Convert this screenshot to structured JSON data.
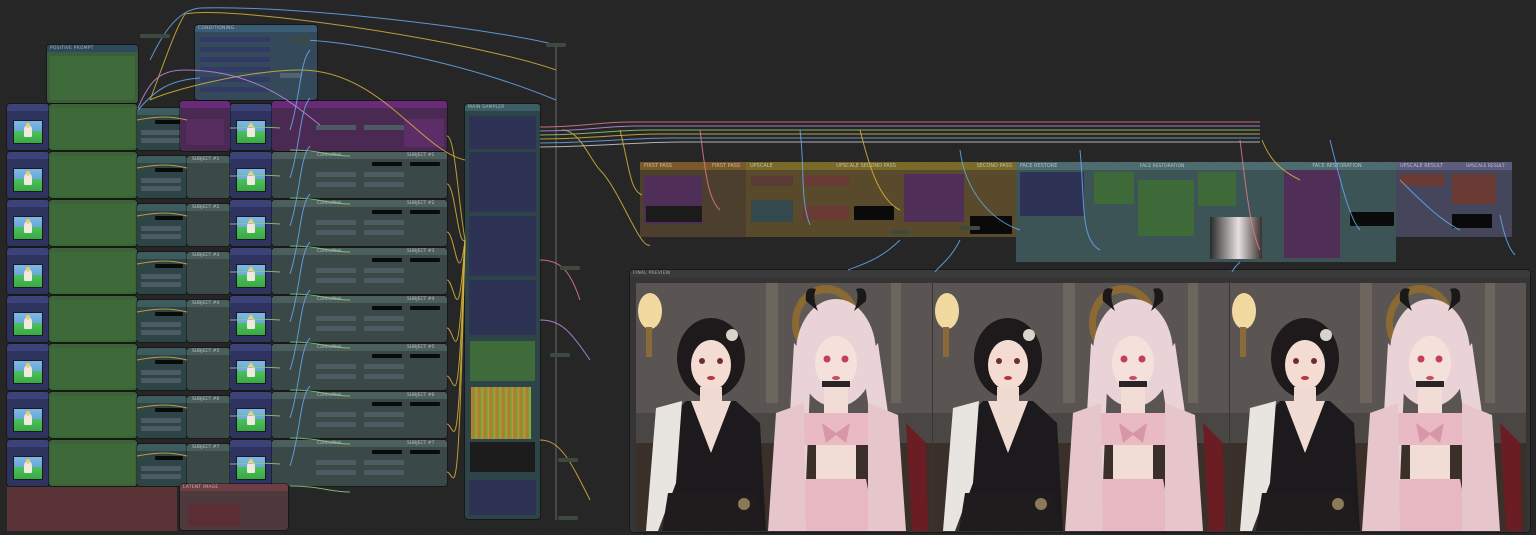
{
  "app": "ComfyUI",
  "node_titles": {
    "prompt_top": "POSITIVE PROMPT",
    "condition_top": "CONDITIONING",
    "sampler_main": "MAIN SAMPLER",
    "final_preview": "FINAL PREVIEW",
    "bottom_right_stack": "LATENT IMAGE"
  },
  "group_titles": {
    "first_pass": "FIRST PASS",
    "first_pass_2": "FIRST PASS",
    "upscale": "UPSCALE",
    "upscale_second": "UPSCALE SECOND PASS",
    "second_pass": "SECOND PASS",
    "face_restore": "FACE RESTORE",
    "face_restoration_1": "FACE RESTORATION",
    "face_restoration_2": "FACE RESTORATION",
    "upscale_result": "UPSCALE RESULT",
    "upscale_result_2": "UPSCALE RESULT"
  },
  "controlnet_label": "ControlNet",
  "subjects": [
    {
      "label": "SUBJECT #1"
    },
    {
      "label": "SUBJECT #2"
    },
    {
      "label": "SUBJECT #3"
    },
    {
      "label": "SUBJECT #4"
    },
    {
      "label": "SUBJECT #5"
    },
    {
      "label": "SUBJECT #6"
    },
    {
      "label": "SUBJECT #7"
    }
  ],
  "colors": {
    "canvas_bg": "#262626",
    "node_green": "#3e6a3a",
    "node_purple": "#4a2a52",
    "node_blue": "#303357",
    "node_teal": "#2f4446",
    "group_orange": "#5a4a2a",
    "group_teal": "#3c5456",
    "group_red": "#6a3a3a",
    "wire_yellow": "#d8b43c",
    "wire_blue": "#66aaee",
    "wire_purple": "#b88ee0",
    "wire_pink": "#e07a8c",
    "wire_green": "#8bd07a"
  },
  "preview_images": [
    {
      "name": "final-output-1"
    },
    {
      "name": "final-output-2"
    },
    {
      "name": "final-output-3"
    }
  ]
}
